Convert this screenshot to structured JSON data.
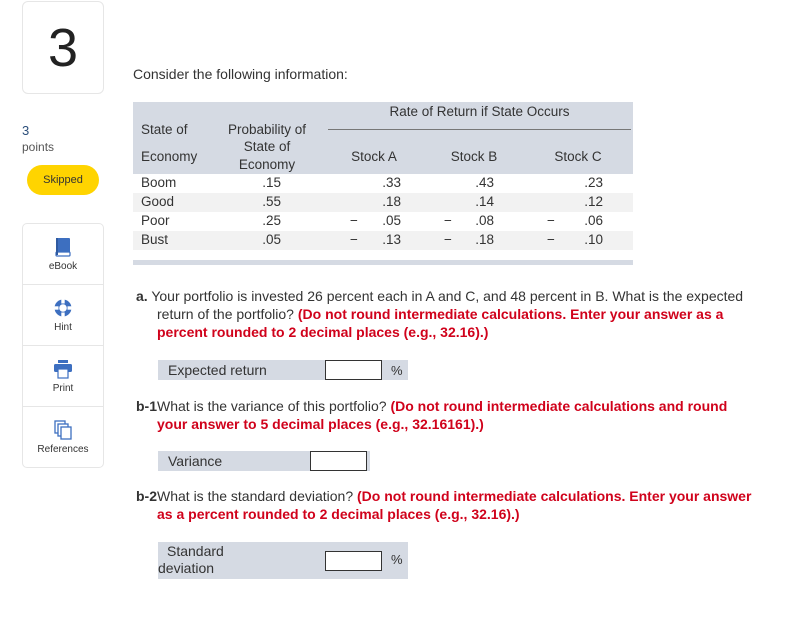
{
  "question": {
    "number": "3",
    "points_value": "3",
    "points_label": "points",
    "status_badge": "Skipped",
    "status_color": "#ffd400"
  },
  "tools": [
    {
      "label": "eBook",
      "icon": "book-icon"
    },
    {
      "label": "Hint",
      "icon": "lifebuoy-icon"
    },
    {
      "label": "Print",
      "icon": "printer-icon"
    },
    {
      "label": "References",
      "icon": "documents-icon"
    }
  ],
  "intro": "Consider the following information:",
  "table": {
    "headers": {
      "state_line1": "State of",
      "state_line2": "Economy",
      "prob_line1": "Probability of",
      "prob_line2": "State of",
      "prob_line3": "Economy",
      "rate_group": "Rate of Return if State Occurs",
      "stock_a": "Stock A",
      "stock_b": "Stock B",
      "stock_c": "Stock C"
    },
    "rows": [
      {
        "state": "Boom",
        "prob": ".15",
        "a_sign": "",
        "a": ".33",
        "b_sign": "",
        "b": ".43",
        "c_sign": "",
        "c": ".23"
      },
      {
        "state": "Good",
        "prob": ".55",
        "a_sign": "",
        "a": ".18",
        "b_sign": "",
        "b": ".14",
        "c_sign": "",
        "c": ".12"
      },
      {
        "state": "Poor",
        "prob": ".25",
        "a_sign": "−",
        "a": ".05",
        "b_sign": "−",
        "b": ".08",
        "c_sign": "−",
        "c": ".06"
      },
      {
        "state": "Bust",
        "prob": ".05",
        "a_sign": "−",
        "a": ".13",
        "b_sign": "−",
        "b": ".18",
        "c_sign": "−",
        "c": ".10"
      }
    ]
  },
  "parts": {
    "a": {
      "label": "a.",
      "text": "Your portfolio is invested 26 percent each in A and C, and 48 percent in B. What is the expected return of the portfolio?",
      "instruction": "(Do not round intermediate calculations. Enter your answer as a percent rounded to 2 decimal places (e.g., 32.16).)",
      "answer_label": "Expected return",
      "answer_value": "",
      "unit": "%"
    },
    "b1": {
      "label": "b-1",
      "text": "What is the variance of this portfolio?",
      "instruction": "(Do not round intermediate calculations and round your answer to 5 decimal places (e.g., 32.16161).)",
      "answer_label": "Variance",
      "answer_value": ""
    },
    "b2": {
      "label": "b-2",
      "text": "What is the standard deviation?",
      "instruction": "(Do not round intermediate calculations. Enter your answer as a percent rounded to 2 decimal places (e.g., 32.16).)",
      "answer_label_line1": "Standard",
      "answer_label_line2": "deviation",
      "answer_value": "",
      "unit": "%"
    }
  }
}
